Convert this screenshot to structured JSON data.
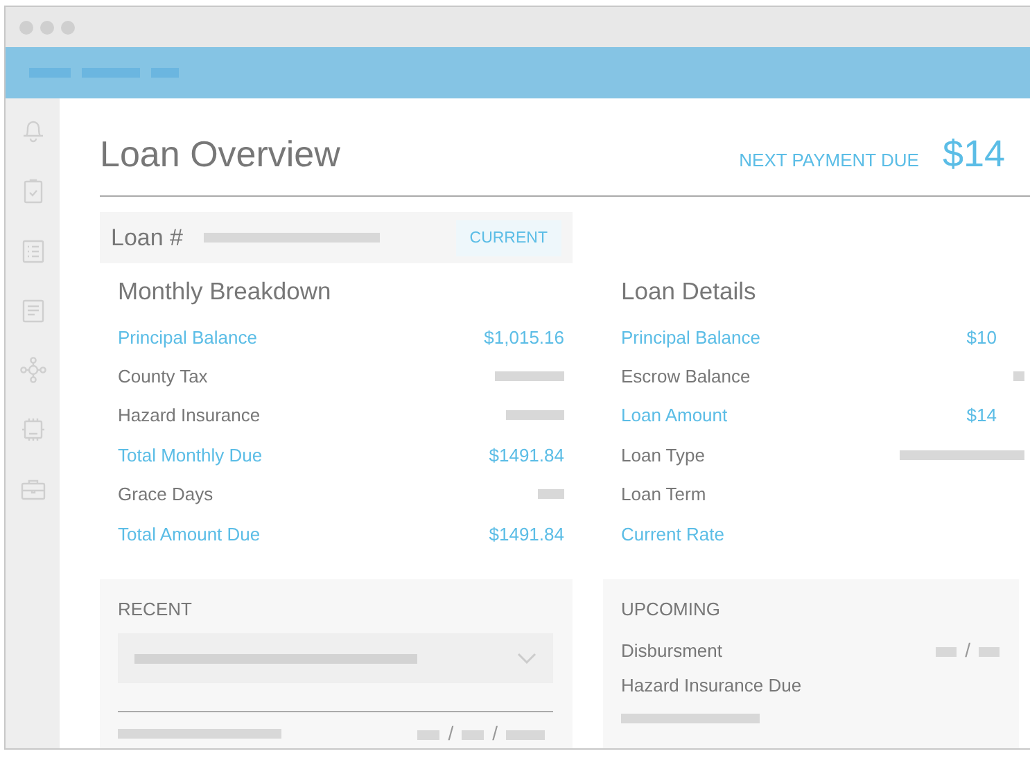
{
  "page": {
    "title": "Loan Overview",
    "next_payment_label": "NEXT PAYMENT DUE",
    "next_payment_amount": "$14"
  },
  "loan_bar": {
    "label": "Loan #",
    "status": "CURRENT"
  },
  "monthly_breakdown": {
    "heading": "Monthly Breakdown",
    "rows": [
      {
        "label": "Principal Balance",
        "emphasized": true,
        "kind": "amount",
        "value": "$1,015.16"
      },
      {
        "label": "County Tax",
        "emphasized": false,
        "kind": "placeholder"
      },
      {
        "label": "Hazard Insurance",
        "emphasized": false,
        "kind": "placeholder"
      },
      {
        "label": "Total Monthly Due",
        "emphasized": true,
        "kind": "amount",
        "value": "$1491.84"
      },
      {
        "label": "Grace Days",
        "emphasized": false,
        "kind": "placeholder"
      },
      {
        "label": "Total Amount Due",
        "emphasized": true,
        "kind": "amount",
        "value": "$1491.84"
      }
    ]
  },
  "loan_details": {
    "heading": "Loan Details",
    "rows": [
      {
        "label": "Principal Balance",
        "emphasized": true,
        "kind": "amount",
        "value": "$10"
      },
      {
        "label": "Escrow Balance",
        "emphasized": false,
        "kind": "placeholder"
      },
      {
        "label": "Loan Amount",
        "emphasized": true,
        "kind": "amount",
        "value": "$14"
      },
      {
        "label": "Loan Type",
        "emphasized": false,
        "kind": "placeholder"
      },
      {
        "label": "Loan Term",
        "emphasized": false,
        "kind": "blank"
      },
      {
        "label": "Current Rate",
        "emphasized": true,
        "kind": "blank"
      }
    ]
  },
  "recent": {
    "heading": "RECENT",
    "date_separators": [
      "/",
      "/"
    ]
  },
  "upcoming": {
    "heading": "UPCOMING",
    "items": [
      {
        "label": "Disbursment",
        "kind": "date",
        "date_separators": [
          "/"
        ]
      },
      {
        "label": "Hazard Insurance Due",
        "kind": "placeholder"
      }
    ]
  }
}
